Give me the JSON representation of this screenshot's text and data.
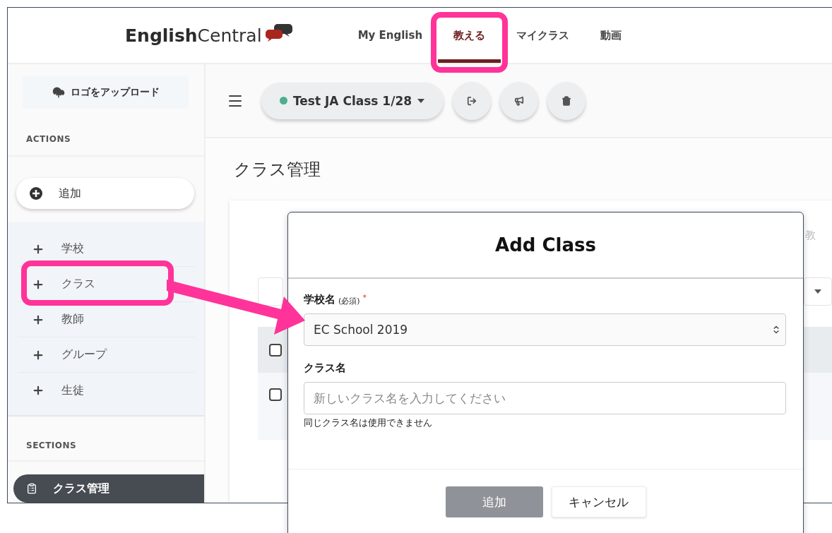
{
  "header": {
    "logo": {
      "bold": "English",
      "light": "Central"
    },
    "nav": [
      {
        "label": "My English",
        "selected": false
      },
      {
        "label": "教える",
        "selected": true
      },
      {
        "label": "マイクラス",
        "selected": false
      },
      {
        "label": "動画",
        "selected": false
      }
    ]
  },
  "sidebar": {
    "upload_button": "ロゴをアップロード",
    "actions_heading": "ACTIONS",
    "add_button": "追加",
    "add_items": [
      {
        "label": "学校"
      },
      {
        "label": "クラス"
      },
      {
        "label": "教師"
      },
      {
        "label": "グループ"
      },
      {
        "label": "生徒"
      }
    ],
    "sections_heading": "SECTIONS",
    "sections": [
      {
        "label": "クラス管理",
        "selected": true
      }
    ]
  },
  "toolbar": {
    "class_selector": {
      "label": "Test JA Class 1/28",
      "color": "#4cae8c"
    }
  },
  "page_title": "クラス管理",
  "background_table": {
    "column_label": "教",
    "rows": [
      {
        "checked": false
      },
      {
        "checked": false
      }
    ]
  },
  "modal": {
    "title": "Add Class",
    "fields": [
      {
        "kind": "select",
        "label": "学校名",
        "note": "(必須)",
        "required_mark": "*",
        "value": "EC School 2019"
      },
      {
        "kind": "text",
        "label": "クラス名",
        "placeholder": "新しいクラス名を入力してください",
        "help": "同じクラス名は使用できません"
      }
    ],
    "buttons": [
      {
        "label": "追加",
        "kind": "primary",
        "disabled": true
      },
      {
        "label": "キャンセル",
        "kind": "secondary"
      }
    ]
  }
}
